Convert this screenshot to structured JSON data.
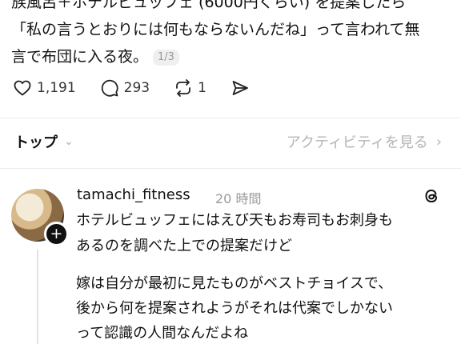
{
  "post": {
    "lines": [
      "族風呂＋ホテルビュッフェ (6000円くらい) を提案したら",
      "「私の言うとおりには何もならないんだね」って言われて無",
      "言で布団に入る夜。"
    ],
    "page_indicator": "1/3",
    "likes": "1,191",
    "comments": "293",
    "reposts": "1"
  },
  "sort": {
    "label": "トップ",
    "activity_link": "アクティビティを見る"
  },
  "reply": {
    "username": "tamachi_fitness",
    "time": "20 時間",
    "lines": [
      "ホテルビュッフェにはえび天もお寿司もお刺身も",
      "あるのを調べた上での提案だけど",
      "嫁は自分が最初に見たものがベストチョイスで、",
      "後から何を提案されようがそれは代案でしかない",
      "って認識の人間なんだよね"
    ]
  }
}
